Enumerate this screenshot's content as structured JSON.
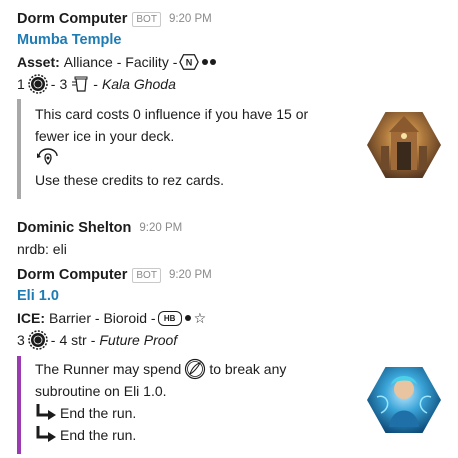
{
  "messages": [
    {
      "sender": "Dorm Computer",
      "bot_label": "BOT",
      "time": "9:20 PM",
      "card": {
        "title": "Mumba Temple",
        "type_prefix": "Asset:",
        "type_text": "Alliance - Facility -",
        "stats_cost": "1",
        "stats_sep1": "-",
        "stats_trash": "3",
        "stats_sep2": "-",
        "flavor_set": "Kala Ghoda",
        "text_line1": "This card costs 0 influence if you have 15 or",
        "text_line2": "fewer ice in your deck.",
        "text_line3": "Use these credits to rez cards."
      }
    },
    {
      "sender": "Dominic Shelton",
      "time": "9:20 PM",
      "body": "nrdb: eli"
    },
    {
      "sender": "Dorm Computer",
      "bot_label": "BOT",
      "time": "9:20 PM",
      "card": {
        "title": "Eli 1.0",
        "type_prefix": "ICE:",
        "type_text": "Barrier - Bioroid -",
        "faction_badge": "HB",
        "stats_cost": "3",
        "stats_sep1": "-",
        "stats_str": "4 str",
        "stats_sep2": "-",
        "flavor_set": "Future Proof",
        "text_line1a": "The Runner may spend",
        "text_line1b": "to break any",
        "text_line2": "subroutine on Eli 1.0.",
        "sub1": "End the run.",
        "sub2": "End the run."
      }
    }
  ],
  "colors": {
    "link": "#1e7bb4",
    "attachment_border_1": "#a8a8a8",
    "attachment_border_2": "#9b3bb2"
  },
  "icons": [
    "nbn-faction-icon",
    "credit-icon",
    "trash-icon",
    "recurring-credit-icon",
    "hb-faction-icon",
    "click-icon",
    "subroutine-icon"
  ]
}
